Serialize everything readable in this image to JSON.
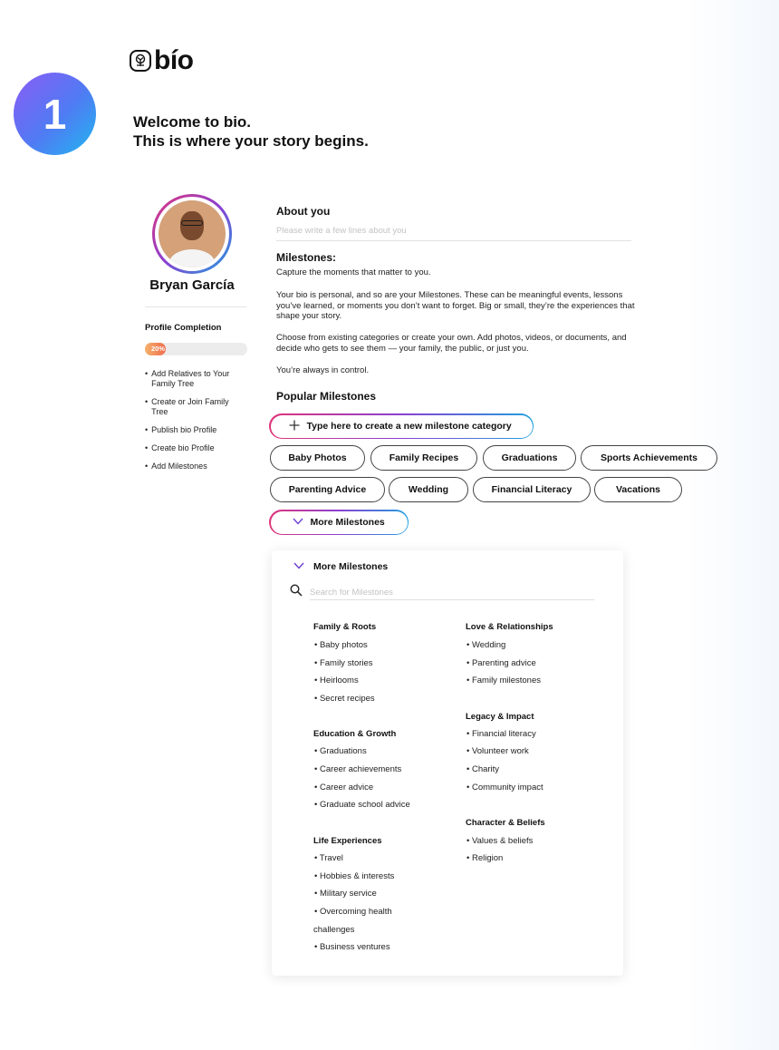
{
  "brand": {
    "logo_text": "bío"
  },
  "step": {
    "number": "1"
  },
  "headline": {
    "line1": "Welcome to bio.",
    "line2": "This is where your story begins."
  },
  "profile": {
    "name": "Bryan García",
    "completion_title": "Profile Completion",
    "completion_percent": 20,
    "completion_label": "20%",
    "todo": [
      "Add Relatives to Your Family Tree",
      "Create or Join Family Tree",
      "Publish bio Profile",
      "Create bio Profile",
      "Add Milestones"
    ]
  },
  "about": {
    "title": "About you",
    "placeholder": "Please write a few lines about you"
  },
  "milestones": {
    "title": "Milestones:",
    "para1": "Capture the moments that matter to you.",
    "para2": "Your bio is personal, and so are your Milestones. These can be meaningful events, lessons you’ve learned, or moments you don’t want to forget. Big or small, they’re the experiences that shape your story.",
    "para3": "Choose from existing categories or create your own. Add photos, videos, or documents, and decide who gets to see them — your family, the public, or just you.",
    "para4": "You’re always in control."
  },
  "popular": {
    "title": "Popular Milestones",
    "create_label": "Type here to create a new milestone category",
    "chips": [
      "Baby Photos",
      "Family Recipes",
      "Graduations",
      "Sports Achievements",
      "Parenting Advice",
      "Wedding",
      "Financial Literacy",
      "Vacations"
    ],
    "more_label": "More Milestones"
  },
  "dropdown": {
    "header": "More Milestones",
    "search_placeholder": "Search for Milestones",
    "left": [
      {
        "title": "Family & Roots",
        "items": [
          "• Baby photos",
          "• Family stories",
          "• Heirlooms",
          "• Secret recipes"
        ]
      },
      {
        "title": "Education & Growth",
        "items": [
          "• Graduations",
          "• Career achievements",
          "• Career advice",
          "• Graduate school advice"
        ]
      },
      {
        "title": "Life Experiences",
        "items": [
          "• Travel",
          "• Hobbies & interests",
          "• Military service",
          "• Overcoming health",
          "challenges",
          "• Business ventures"
        ]
      }
    ],
    "right": [
      {
        "title": "Love & Relationships",
        "items": [
          "• Wedding",
          "• Parenting advice",
          "• Family milestones"
        ]
      },
      {
        "title": "Legacy & Impact",
        "items": [
          "• Financial literacy",
          "• Volunteer work",
          "• Charity",
          "• Community impact"
        ]
      },
      {
        "title": "Character & Beliefs",
        "items": [
          "• Values & beliefs",
          "• Religion"
        ]
      }
    ]
  },
  "colors": {
    "accent_gradient_start": "#e0357a",
    "accent_gradient_mid": "#8a3fd1",
    "accent_gradient_end": "#1fa0e0",
    "progress_start": "#f6b26b",
    "progress_end": "#ee6c4d"
  },
  "icons": {
    "logo": "tree-logo-icon",
    "plus": "plus-icon",
    "chevron": "chevron-down-icon",
    "search": "search-icon"
  }
}
